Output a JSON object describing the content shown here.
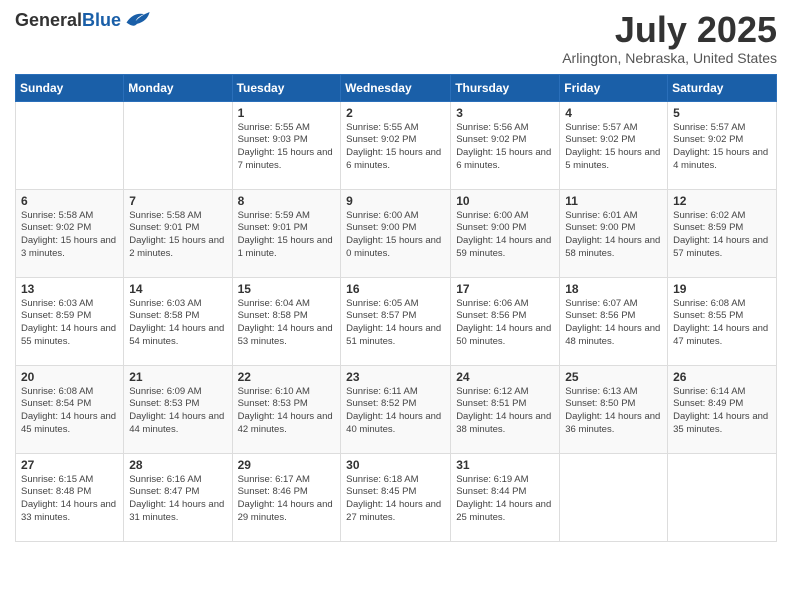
{
  "header": {
    "logo_general": "General",
    "logo_blue": "Blue",
    "title": "July 2025",
    "subtitle": "Arlington, Nebraska, United States"
  },
  "days_of_week": [
    "Sunday",
    "Monday",
    "Tuesday",
    "Wednesday",
    "Thursday",
    "Friday",
    "Saturday"
  ],
  "weeks": [
    [
      {
        "day": "",
        "content": ""
      },
      {
        "day": "",
        "content": ""
      },
      {
        "day": "1",
        "content": "Sunrise: 5:55 AM\nSunset: 9:03 PM\nDaylight: 15 hours and 7 minutes."
      },
      {
        "day": "2",
        "content": "Sunrise: 5:55 AM\nSunset: 9:02 PM\nDaylight: 15 hours and 6 minutes."
      },
      {
        "day": "3",
        "content": "Sunrise: 5:56 AM\nSunset: 9:02 PM\nDaylight: 15 hours and 6 minutes."
      },
      {
        "day": "4",
        "content": "Sunrise: 5:57 AM\nSunset: 9:02 PM\nDaylight: 15 hours and 5 minutes."
      },
      {
        "day": "5",
        "content": "Sunrise: 5:57 AM\nSunset: 9:02 PM\nDaylight: 15 hours and 4 minutes."
      }
    ],
    [
      {
        "day": "6",
        "content": "Sunrise: 5:58 AM\nSunset: 9:02 PM\nDaylight: 15 hours and 3 minutes."
      },
      {
        "day": "7",
        "content": "Sunrise: 5:58 AM\nSunset: 9:01 PM\nDaylight: 15 hours and 2 minutes."
      },
      {
        "day": "8",
        "content": "Sunrise: 5:59 AM\nSunset: 9:01 PM\nDaylight: 15 hours and 1 minute."
      },
      {
        "day": "9",
        "content": "Sunrise: 6:00 AM\nSunset: 9:00 PM\nDaylight: 15 hours and 0 minutes."
      },
      {
        "day": "10",
        "content": "Sunrise: 6:00 AM\nSunset: 9:00 PM\nDaylight: 14 hours and 59 minutes."
      },
      {
        "day": "11",
        "content": "Sunrise: 6:01 AM\nSunset: 9:00 PM\nDaylight: 14 hours and 58 minutes."
      },
      {
        "day": "12",
        "content": "Sunrise: 6:02 AM\nSunset: 8:59 PM\nDaylight: 14 hours and 57 minutes."
      }
    ],
    [
      {
        "day": "13",
        "content": "Sunrise: 6:03 AM\nSunset: 8:59 PM\nDaylight: 14 hours and 55 minutes."
      },
      {
        "day": "14",
        "content": "Sunrise: 6:03 AM\nSunset: 8:58 PM\nDaylight: 14 hours and 54 minutes."
      },
      {
        "day": "15",
        "content": "Sunrise: 6:04 AM\nSunset: 8:58 PM\nDaylight: 14 hours and 53 minutes."
      },
      {
        "day": "16",
        "content": "Sunrise: 6:05 AM\nSunset: 8:57 PM\nDaylight: 14 hours and 51 minutes."
      },
      {
        "day": "17",
        "content": "Sunrise: 6:06 AM\nSunset: 8:56 PM\nDaylight: 14 hours and 50 minutes."
      },
      {
        "day": "18",
        "content": "Sunrise: 6:07 AM\nSunset: 8:56 PM\nDaylight: 14 hours and 48 minutes."
      },
      {
        "day": "19",
        "content": "Sunrise: 6:08 AM\nSunset: 8:55 PM\nDaylight: 14 hours and 47 minutes."
      }
    ],
    [
      {
        "day": "20",
        "content": "Sunrise: 6:08 AM\nSunset: 8:54 PM\nDaylight: 14 hours and 45 minutes."
      },
      {
        "day": "21",
        "content": "Sunrise: 6:09 AM\nSunset: 8:53 PM\nDaylight: 14 hours and 44 minutes."
      },
      {
        "day": "22",
        "content": "Sunrise: 6:10 AM\nSunset: 8:53 PM\nDaylight: 14 hours and 42 minutes."
      },
      {
        "day": "23",
        "content": "Sunrise: 6:11 AM\nSunset: 8:52 PM\nDaylight: 14 hours and 40 minutes."
      },
      {
        "day": "24",
        "content": "Sunrise: 6:12 AM\nSunset: 8:51 PM\nDaylight: 14 hours and 38 minutes."
      },
      {
        "day": "25",
        "content": "Sunrise: 6:13 AM\nSunset: 8:50 PM\nDaylight: 14 hours and 36 minutes."
      },
      {
        "day": "26",
        "content": "Sunrise: 6:14 AM\nSunset: 8:49 PM\nDaylight: 14 hours and 35 minutes."
      }
    ],
    [
      {
        "day": "27",
        "content": "Sunrise: 6:15 AM\nSunset: 8:48 PM\nDaylight: 14 hours and 33 minutes."
      },
      {
        "day": "28",
        "content": "Sunrise: 6:16 AM\nSunset: 8:47 PM\nDaylight: 14 hours and 31 minutes."
      },
      {
        "day": "29",
        "content": "Sunrise: 6:17 AM\nSunset: 8:46 PM\nDaylight: 14 hours and 29 minutes."
      },
      {
        "day": "30",
        "content": "Sunrise: 6:18 AM\nSunset: 8:45 PM\nDaylight: 14 hours and 27 minutes."
      },
      {
        "day": "31",
        "content": "Sunrise: 6:19 AM\nSunset: 8:44 PM\nDaylight: 14 hours and 25 minutes."
      },
      {
        "day": "",
        "content": ""
      },
      {
        "day": "",
        "content": ""
      }
    ]
  ]
}
